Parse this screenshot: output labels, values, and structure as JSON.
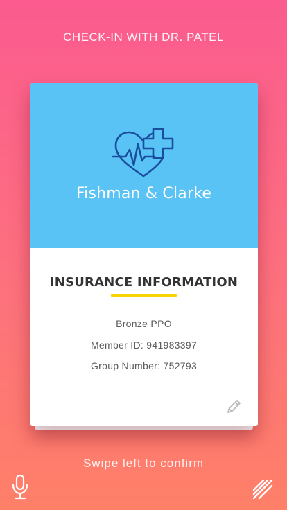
{
  "header": {
    "title": "CHECK-IN WITH DR. PATEL"
  },
  "card": {
    "provider_name": "Fishman & Clarke",
    "logo_icon": "heart-cross-pulse-icon",
    "section_heading": "INSURANCE INFORMATION",
    "lines": [
      "Bronze PPO",
      "Member ID: 941983397",
      "Group Number: 752793"
    ],
    "edit_icon": "pencil-icon"
  },
  "footer": {
    "swipe_hint": "Swipe left to confirm",
    "mic_icon": "microphone-icon",
    "menu_icon": "menu-lines-icon"
  },
  "colors": {
    "background_top": "#fb5b8f",
    "background_bottom": "#fe8068",
    "hero_blue": "#5ac3f6",
    "logo_stroke": "#1a4e9c",
    "accent_yellow": "#f5d400"
  }
}
